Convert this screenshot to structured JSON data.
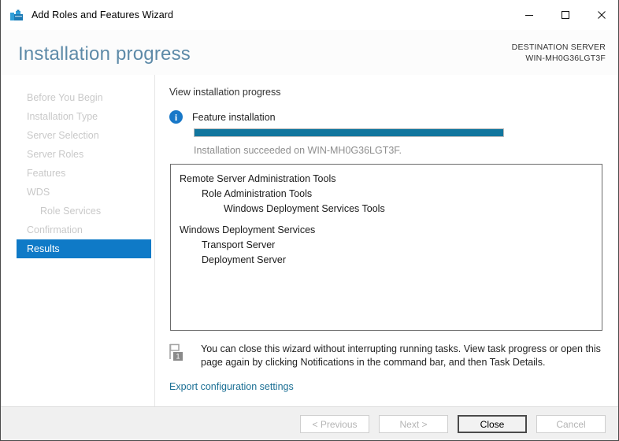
{
  "window": {
    "title": "Add Roles and Features Wizard",
    "icon": "server-roles-icon",
    "controls": {
      "minimize": "minimize-icon",
      "maximize": "maximize-icon",
      "close": "close-icon"
    }
  },
  "header": {
    "page_title": "Installation progress",
    "destination_label": "DESTINATION SERVER",
    "destination_value": "WIN-MH0G36LGT3F",
    "title_color": "#5d8aa8"
  },
  "sidebar": {
    "items": [
      {
        "label": "Before You Begin",
        "selected": false,
        "indent": false
      },
      {
        "label": "Installation Type",
        "selected": false,
        "indent": false
      },
      {
        "label": "Server Selection",
        "selected": false,
        "indent": false
      },
      {
        "label": "Server Roles",
        "selected": false,
        "indent": false
      },
      {
        "label": "Features",
        "selected": false,
        "indent": false
      },
      {
        "label": "WDS",
        "selected": false,
        "indent": false
      },
      {
        "label": "Role Services",
        "selected": false,
        "indent": true
      },
      {
        "label": "Confirmation",
        "selected": false,
        "indent": false
      },
      {
        "label": "Results",
        "selected": true,
        "indent": false
      }
    ],
    "selected_color": "#0f7ac7"
  },
  "main": {
    "heading": "View installation progress",
    "info_icon": "info-icon",
    "info_label": "Feature installation",
    "progress": {
      "percent": 100,
      "fill_color": "#11769e"
    },
    "status_text": "Installation succeeded on WIN-MH0G36LGT3F.",
    "results": [
      {
        "label": "Remote Server Administration Tools",
        "level": 0,
        "gap_before": false
      },
      {
        "label": "Role Administration Tools",
        "level": 1,
        "gap_before": false
      },
      {
        "label": "Windows Deployment Services Tools",
        "level": 2,
        "gap_before": false
      },
      {
        "label": "Windows Deployment Services",
        "level": 0,
        "gap_before": true
      },
      {
        "label": "Transport Server",
        "level": 1,
        "gap_before": false
      },
      {
        "label": "Deployment Server",
        "level": 1,
        "gap_before": false
      }
    ],
    "notice": {
      "icon": "notification-flag-icon",
      "badge": "1",
      "text": "You can close this wizard without interrupting running tasks. View task progress or open this page again by clicking Notifications in the command bar, and then Task Details."
    },
    "export_link": "Export configuration settings",
    "link_color": "#1b6f94"
  },
  "footer": {
    "buttons": [
      {
        "label": "< Previous",
        "enabled": false
      },
      {
        "label": "Next >",
        "enabled": false
      },
      {
        "label": "Close",
        "enabled": true
      },
      {
        "label": "Cancel",
        "enabled": false
      }
    ]
  }
}
